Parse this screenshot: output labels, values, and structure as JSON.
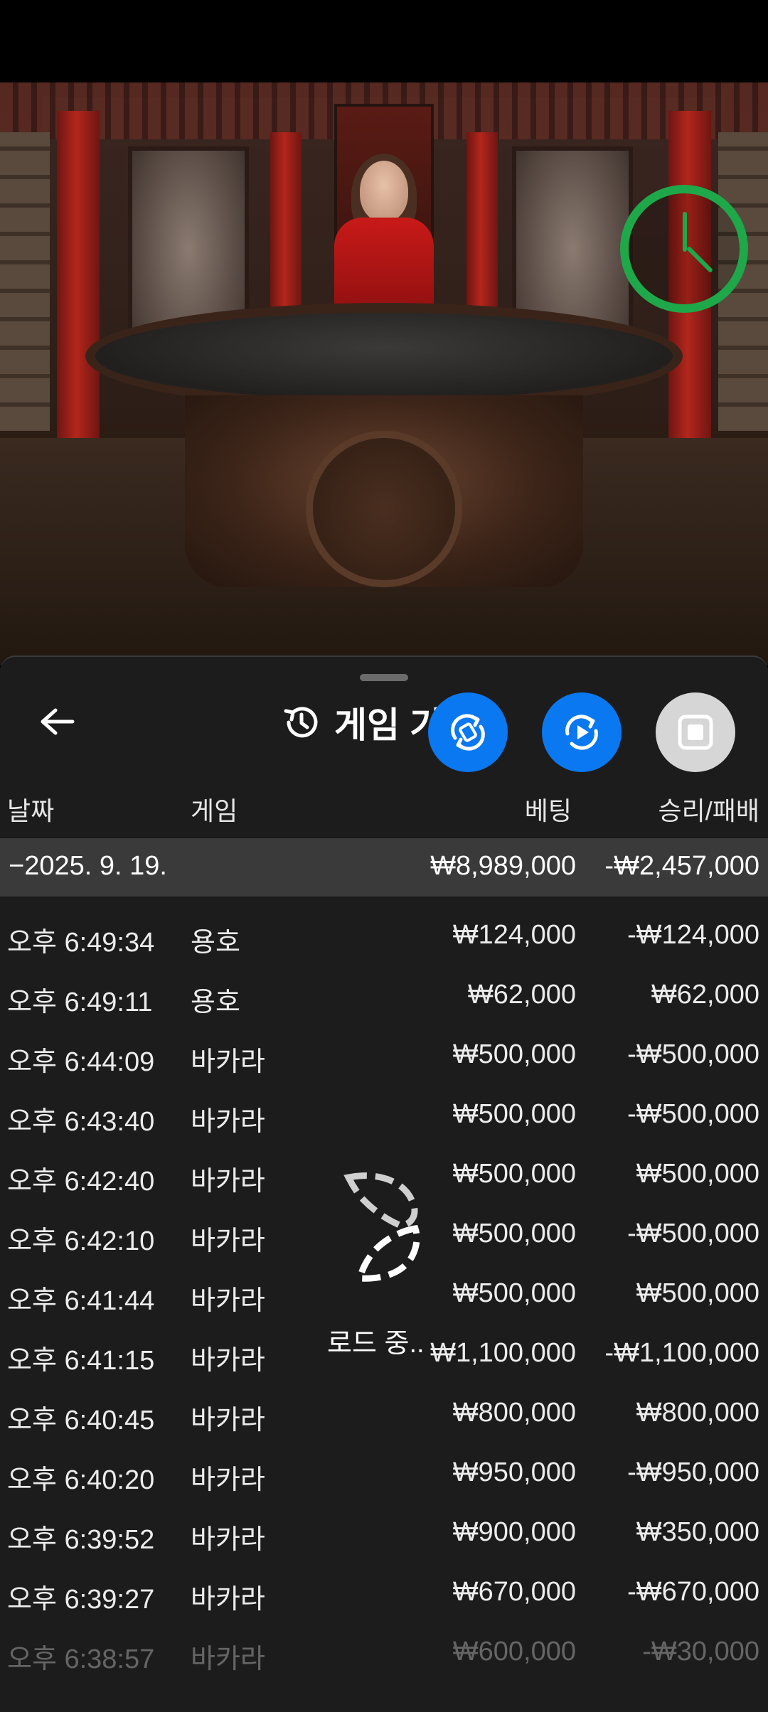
{
  "header": {
    "title": "게임 기록",
    "back_icon": "arrow-left-icon",
    "history_icon": "history-icon"
  },
  "fabs": [
    {
      "icon": "swap-icon",
      "color": "#0a78f0"
    },
    {
      "icon": "replay-icon",
      "color": "#0a78f0"
    },
    {
      "icon": "stop-icon",
      "color": "#d6d6d6"
    }
  ],
  "table": {
    "columns": [
      "날짜",
      "게임",
      "베팅",
      "승리/패배"
    ],
    "group": {
      "date": "−2025. 9. 19.",
      "bet": "₩8,989,000",
      "result": "-₩2,457,000"
    },
    "rows": [
      {
        "time": "오후 6:49:34",
        "game": "용호",
        "bet": "₩124,000",
        "result": "-₩124,000"
      },
      {
        "time": "오후 6:49:11",
        "game": "용호",
        "bet": "₩62,000",
        "result": "₩62,000"
      },
      {
        "time": "오후 6:44:09",
        "game": "바카라",
        "bet": "₩500,000",
        "result": "-₩500,000"
      },
      {
        "time": "오후 6:43:40",
        "game": "바카라",
        "bet": "₩500,000",
        "result": "-₩500,000"
      },
      {
        "time": "오후 6:42:40",
        "game": "바카라",
        "bet": "₩500,000",
        "result": "₩500,000"
      },
      {
        "time": "오후 6:42:10",
        "game": "바카라",
        "bet": "₩500,000",
        "result": "-₩500,000"
      },
      {
        "time": "오후 6:41:44",
        "game": "바카라",
        "bet": "₩500,000",
        "result": "₩500,000"
      },
      {
        "time": "오후 6:41:15",
        "game": "바카라",
        "bet": "₩1,100,000",
        "result": "-₩1,100,000"
      },
      {
        "time": "오후 6:40:45",
        "game": "바카라",
        "bet": "₩800,000",
        "result": "₩800,000"
      },
      {
        "time": "오후 6:40:20",
        "game": "바카라",
        "bet": "₩950,000",
        "result": "-₩950,000"
      },
      {
        "time": "오후 6:39:52",
        "game": "바카라",
        "bet": "₩900,000",
        "result": "₩350,000"
      },
      {
        "time": "오후 6:39:27",
        "game": "바카라",
        "bet": "₩670,000",
        "result": "-₩670,000"
      },
      {
        "time": "오후 6:38:57",
        "game": "바카라",
        "bet": "₩600,000",
        "result": "-₩30,000"
      }
    ]
  },
  "loading": {
    "text": "로드 중..",
    "icon": "loading-logo-icon"
  },
  "video": {
    "timer_icon": "timer-clock-icon",
    "timer_color": "#1ea84a"
  }
}
